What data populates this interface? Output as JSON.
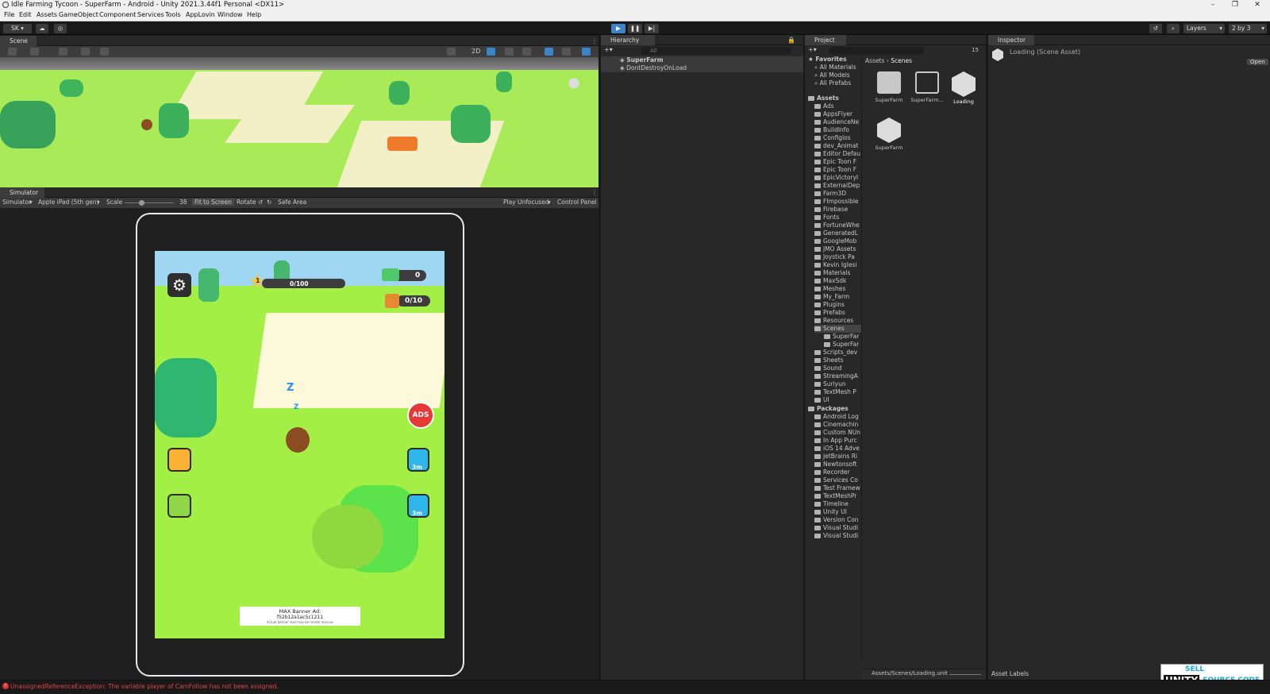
{
  "window": {
    "title": "Idle Farming Tycoon - SuperFarm - Android - Unity 2021.3.44f1 Personal <DX11>"
  },
  "menu": [
    "File",
    "Edit",
    "Assets",
    "GameObject",
    "Component",
    "Services",
    "Tools",
    "AppLovin",
    "Window",
    "Help"
  ],
  "toolbar": {
    "account": "SK",
    "layers": "Layers",
    "layout": "2 by 3"
  },
  "scene": {
    "tab": "Scene",
    "mode_2d": "2D"
  },
  "simulator": {
    "tab": "Simulator",
    "mode": "Simulator",
    "device": "Apple iPad (5th gen)",
    "scale_label": "Scale",
    "scale_value": "38",
    "fit": "Fit to Screen",
    "rotate": "Rotate",
    "safe_area": "Safe Area",
    "play_mode": "Play Unfocused",
    "control_panel": "Control Panel"
  },
  "game": {
    "level": "1",
    "xp": "0/100",
    "xp_fraction": 0,
    "cash": "0",
    "storage": "0/10",
    "ads": "ADS",
    "timer1": "3m",
    "timer2": "3m",
    "banner_title": "MAX Banner Ad:",
    "banner_id": "f52b12a1ac5c1211",
    "banner_note": "Actual banner size may be render devices"
  },
  "hierarchy": {
    "tab": "Hierarchy",
    "search_placeholder": "All",
    "items": [
      "SuperFarm",
      "DontDestroyOnLoad"
    ]
  },
  "project": {
    "tab": "Project",
    "hidden_count": "15",
    "favorites_label": "Favorites",
    "favorites": [
      "All Materials",
      "All Models",
      "All Prefabs"
    ],
    "assets_label": "Assets",
    "folders": [
      "Ads",
      "AppsFlyer",
      "AudienceNe",
      "BuildInfo",
      "Configlos",
      "dev_Animat",
      "Editor Defau",
      "Epic Toon F",
      "Epic Toon F",
      "EpicVictoryI",
      "ExternalDep",
      "Farm3D",
      "FImpossible",
      "Firebase",
      "Fonts",
      "FortuneWhe",
      "GeneratedL",
      "GoogleMob",
      "JMO Assets",
      "Joystick Pa",
      "Kevin Iglesi",
      "Materials",
      "MaxSdk",
      "Meshes",
      "My_Farm",
      "Plugins",
      "Prefabs",
      "Resources",
      "Scenes",
      "SuperFar",
      "SuperFar",
      "Scripts_dev",
      "Sheets",
      "Sound",
      "StreamingA",
      "Suriyun",
      "TextMesh P",
      "UI"
    ],
    "packages_label": "Packages",
    "packages": [
      "Android Log",
      "Cinemachin",
      "Custom NUn",
      "In App Purc",
      "iOS 14 Adve",
      "JetBrains Ri",
      "Newtonsoft",
      "Recorder",
      "Services Co",
      "Test Framew",
      "TextMeshPr",
      "Timeline",
      "Unity UI",
      "Version Con",
      "Visual Studi",
      "Visual Studi"
    ],
    "breadcrumb": [
      "Assets",
      "Scenes"
    ],
    "grid": [
      "SuperFarm",
      "SuperFarm...",
      "Loading",
      "SuperFarm"
    ],
    "footer_path": "Assets/Scenes/Loading.unit"
  },
  "inspector": {
    "tab": "Inspector",
    "title": "Loading (Scene Asset)",
    "open": "Open",
    "asset_labels": "Asset Labels"
  },
  "watermark": {
    "line1": "SELL",
    "line2": "UNITY",
    "line3": "SOURCE CODE"
  },
  "status": {
    "error": "UnassignedReferenceException: The variable player of CamFollow has not been assigned."
  }
}
